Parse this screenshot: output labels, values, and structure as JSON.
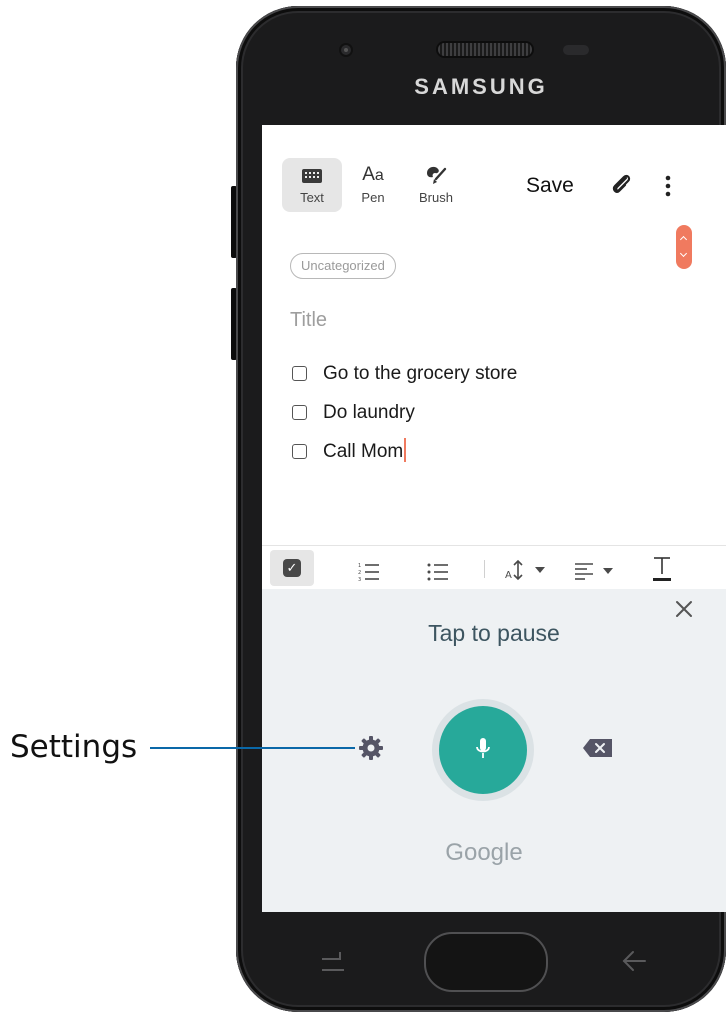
{
  "device": {
    "brand": "SAMSUNG"
  },
  "note_app": {
    "modes": [
      {
        "label": "Text",
        "icon": "keyboard-icon",
        "active": true
      },
      {
        "label": "Pen",
        "icon": "pen-aa-icon",
        "active": false
      },
      {
        "label": "Brush",
        "icon": "brush-icon",
        "active": false
      }
    ],
    "save_label": "Save",
    "category": "Uncategorized",
    "title_placeholder": "Title",
    "checklist": [
      {
        "text": "Go to the grocery store",
        "checked": false
      },
      {
        "text": "Do laundry",
        "checked": false
      },
      {
        "text": "Call Mom",
        "checked": false
      }
    ],
    "format_bar": {
      "icons": [
        "checkbox-icon",
        "numbered-list-icon",
        "bulleted-list-icon",
        "text-size-icon",
        "align-icon",
        "text-style-icon"
      ]
    }
  },
  "voice_input": {
    "status": "Tap to pause",
    "provider": "Google",
    "icons": [
      "close-icon",
      "settings-gear-icon",
      "microphone-icon",
      "backspace-icon"
    ]
  },
  "callout": {
    "label": "Settings"
  },
  "colors": {
    "accent": "#F07A5F",
    "mic": "#27A99A",
    "callout_line": "#0A68A8",
    "voice_bg": "#EEF1F3"
  }
}
